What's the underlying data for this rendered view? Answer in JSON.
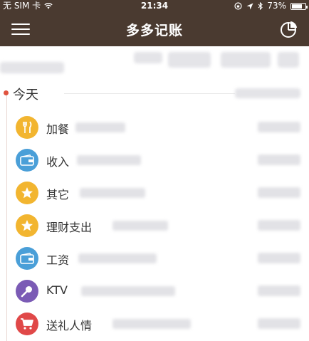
{
  "status_bar": {
    "carrier": "无 SIM 卡",
    "time": "21:34",
    "battery": "73%"
  },
  "nav": {
    "title": "多多记账"
  },
  "timeline": {
    "date_label": "今天",
    "entries": [
      {
        "name": "加餐",
        "icon": "fork-knife-icon",
        "color": "#f2b530"
      },
      {
        "name": "收入",
        "icon": "wallet-icon",
        "color": "#4a9fd8"
      },
      {
        "name": "其它",
        "icon": "star-icon",
        "color": "#f2b530"
      },
      {
        "name": "理财支出",
        "icon": "star-icon",
        "color": "#f2b530"
      },
      {
        "name": "工资",
        "icon": "wallet-icon",
        "color": "#4a9fd8"
      },
      {
        "name": "KTV",
        "icon": "microphone-icon",
        "color": "#7b5bb5"
      },
      {
        "name": "送礼人情",
        "icon": "cart-icon",
        "color": "#e04848"
      }
    ]
  }
}
